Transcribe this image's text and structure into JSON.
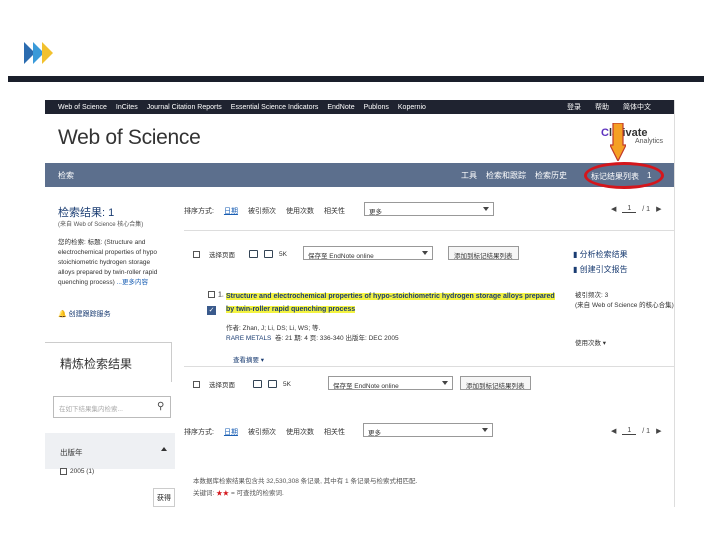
{
  "slide": {
    "chevron_colors": [
      "#2b6cb0",
      "#3a9ad9",
      "#f2c12e"
    ]
  },
  "topbar": {
    "nav": [
      "Web of Science",
      "InCites",
      "Journal Citation Reports",
      "Essential Science Indicators",
      "EndNote",
      "Publons",
      "Kopernio"
    ],
    "right": [
      "登录",
      "帮助",
      "简体中文"
    ]
  },
  "header": {
    "brand": "Web of Science",
    "clarivate_c": "C",
    "clarivate": "larivate",
    "clarivate_sub": "Analytics"
  },
  "searchbar": {
    "label": "检索",
    "tools": [
      "工具",
      "检索和跟踪",
      "检索历史"
    ],
    "marked_list": "标记结果列表",
    "marked_count": "1"
  },
  "sidebar": {
    "results_title": "检索结果: 1",
    "results_source": "(来自 Web of Science 核心合集)",
    "query_label": "您的检索: 标题:",
    "query_text": "(Structure and electrochemical properties of hypo stoichiometric hydrogen storage alloys prepared by twin-roller rapid quenching process)",
    "more": "...更多内容",
    "alert": "创建跟踪服务",
    "refine_title": "精炼检索结果",
    "refine_placeholder": "在如下结果集内检索...",
    "pubyear": "出版年",
    "year_option": "2005 (1)",
    "tab": "获得"
  },
  "sort": {
    "label": "排序方式:",
    "options": [
      "日期",
      "被引频次",
      "使用次数",
      "相关性"
    ],
    "more": "更多",
    "page": "1",
    "of_pages": "/ 1"
  },
  "toolbar": {
    "select_page": "选择页面",
    "export_label": "5K",
    "endnote": "保存至 EndNote online",
    "add_marked": "添加到标记结果列表",
    "analyze": "分析检索结果",
    "citation_report": "创建引文报告"
  },
  "record": {
    "num": "1.",
    "title_hl": "Structure and electrochemical properties of hypo-stoichiometric hydrogen storage alloys prepared by twin-roller rapid quenching process",
    "authors": "作者: Zhan, J; Li, DS; Li, WS; 等.",
    "journal": "RARE METALS",
    "details": "卷: 21  期: 4  页: 336-340  出版年: DEC 2005",
    "abstract": "查看摘要 ▾",
    "cited_label": "被引频次: 3",
    "cited_src": "(来自 Web of Science 的核心合集)",
    "usage": "使用次数 ▾"
  },
  "footer": {
    "line1": "本数据库检索结果包含共 32,530,308 条记录, 其中有 1 条记录与检索式相匹配.",
    "line2_prefix": "关键词:",
    "line2_red": "★★",
    "line2_suffix": "= 可查找的检索词."
  }
}
